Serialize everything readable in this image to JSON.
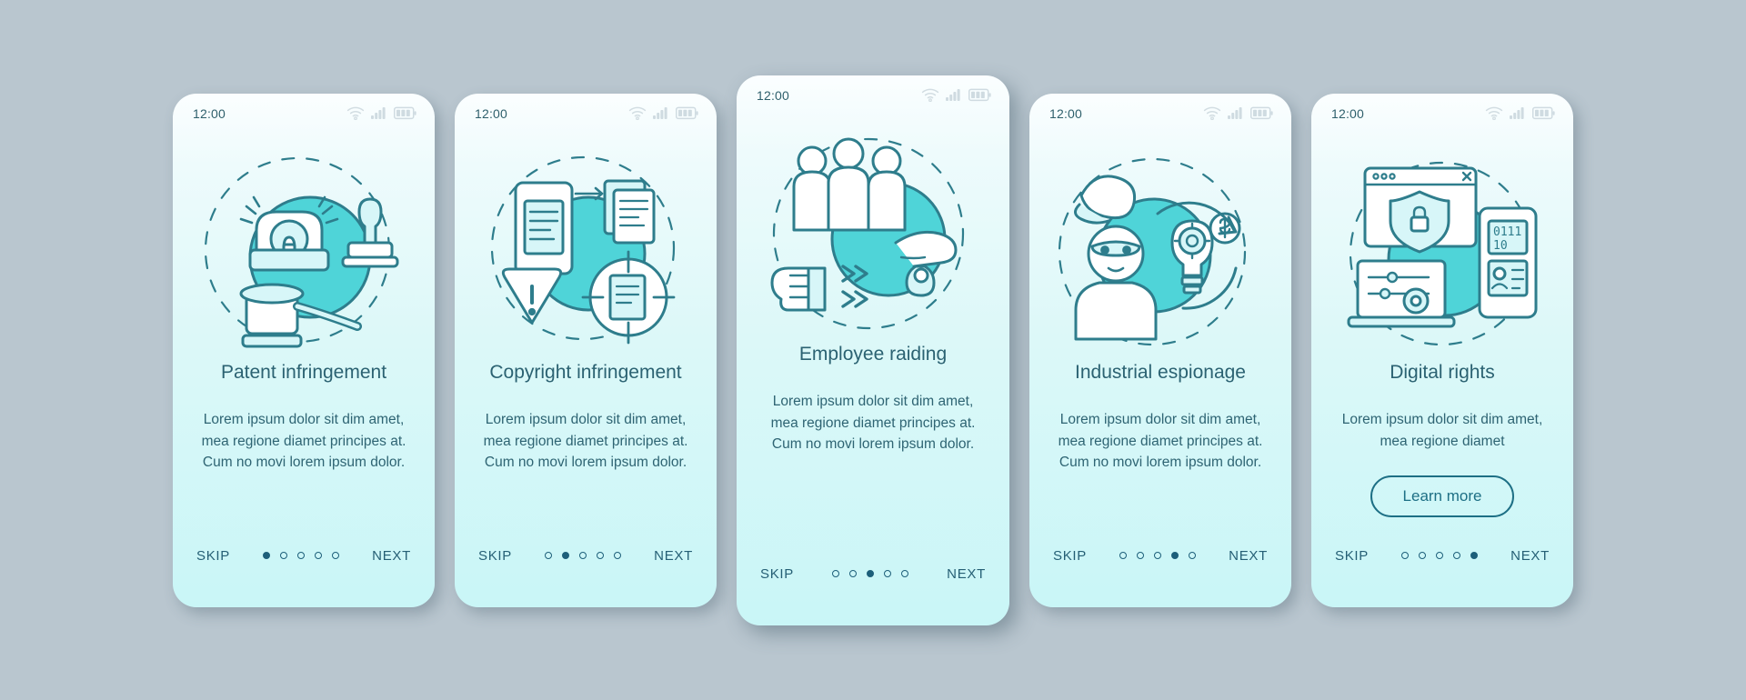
{
  "theme": {
    "page_background": "#b9c6cf",
    "card_gradient_top": "#fbfeff",
    "card_gradient_bottom": "#c9f6f7",
    "accent_teal": "#45d3d8",
    "ink": "#2b6272",
    "line": "#1d6f85"
  },
  "status": {
    "time": "12:00",
    "icons": [
      "wifi-icon",
      "cellular-signal-icon",
      "battery-icon"
    ]
  },
  "footer": {
    "skip_label": "SKIP",
    "next_label": "NEXT",
    "dot_count": 5
  },
  "screens": [
    {
      "id": "patent-infringement",
      "illustration": "gavel-stamp-siren-illustration",
      "title": "Patent infringement",
      "body": "Lorem ipsum dolor sit dim amet, mea regione diamet principes at. Cum no movi lorem ipsum dolor.",
      "active_dot": 1,
      "button": null
    },
    {
      "id": "copyright-infringement",
      "illustration": "documents-target-warning-illustration",
      "title": "Copyright infringement",
      "body": "Lorem ipsum dolor sit dim amet, mea regione diamet principes at. Cum no movi lorem ipsum dolor.",
      "active_dot": 2,
      "button": null
    },
    {
      "id": "employee-raiding",
      "illustration": "people-magnet-illustration",
      "title": "Employee raiding",
      "body": "Lorem ipsum dolor sit dim amet, mea regione diamet principes at. Cum no movi lorem ipsum dolor.",
      "active_dot": 3,
      "button": null
    },
    {
      "id": "industrial-espionage",
      "illustration": "spy-lightbulb-illustration",
      "title": "Industrial espionage",
      "body": "Lorem ipsum dolor sit dim amet, mea regione diamet principes at. Cum no movi lorem ipsum dolor.",
      "active_dot": 4,
      "button": null
    },
    {
      "id": "digital-rights",
      "illustration": "browser-shield-devices-illustration",
      "title": "Digital rights",
      "body": "Lorem ipsum dolor sit dim amet, mea regione diamet",
      "active_dot": 5,
      "button": "Learn more"
    }
  ]
}
